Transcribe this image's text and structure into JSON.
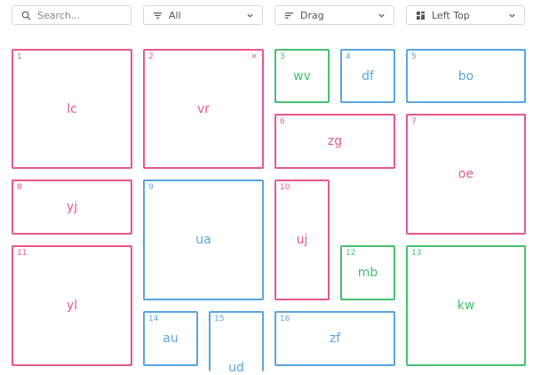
{
  "toolbar": {
    "search": {
      "placeholder": "Search...",
      "icon": "search-icon"
    },
    "filter": {
      "value": "All",
      "icon": "filter-icon"
    },
    "mode": {
      "value": "Drag",
      "icon": "sort-icon"
    },
    "position": {
      "value": "Left Top",
      "icon": "grid-layout-icon"
    }
  },
  "colors": {
    "pink": "#e8588a",
    "blue": "#5aa5e0",
    "green": "#45c16e"
  },
  "tiles": [
    {
      "num": "1",
      "label": "lc",
      "color": "pink"
    },
    {
      "num": "2",
      "label": "vr",
      "color": "pink",
      "close": "×"
    },
    {
      "num": "3",
      "label": "wv",
      "color": "green"
    },
    {
      "num": "4",
      "label": "df",
      "color": "blue"
    },
    {
      "num": "5",
      "label": "bo",
      "color": "blue"
    },
    {
      "num": "6",
      "label": "zg",
      "color": "pink"
    },
    {
      "num": "7",
      "label": "oe",
      "color": "pink"
    },
    {
      "num": "8",
      "label": "yj",
      "color": "pink"
    },
    {
      "num": "9",
      "label": "ua",
      "color": "blue"
    },
    {
      "num": "10",
      "label": "uj",
      "color": "pink"
    },
    {
      "num": "11",
      "label": "yl",
      "color": "pink"
    },
    {
      "num": "12",
      "label": "mb",
      "color": "green"
    },
    {
      "num": "13",
      "label": "kw",
      "color": "green"
    },
    {
      "num": "14",
      "label": "au",
      "color": "blue"
    },
    {
      "num": "15",
      "label": "ud",
      "color": "blue"
    },
    {
      "num": "16",
      "label": "zf",
      "color": "blue"
    }
  ]
}
